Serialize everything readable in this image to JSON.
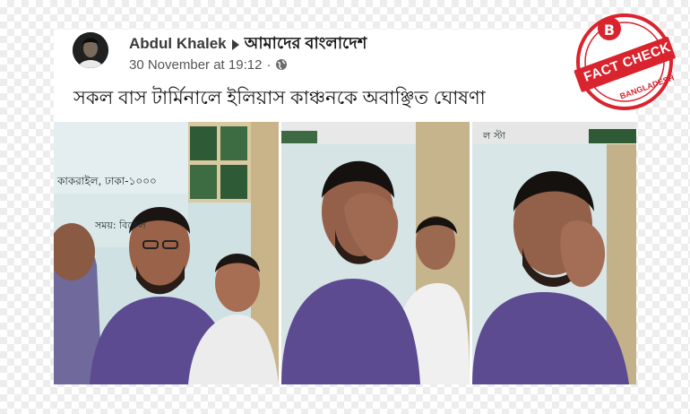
{
  "post": {
    "author": "Abdul Khalek",
    "group": "আমাদের বাংলাদেশ",
    "timestamp": "30 November at 19:12",
    "separator": "·",
    "text": "সকল বাস টার্মিনালে ইলিয়াস কাঞ্চনকে অবাঞ্ছিত ঘোষণা"
  },
  "photos": {
    "banner_text": "কাকরাইল, ঢাকা-১০০০",
    "banner_text_2": "সময়: বিকেল",
    "banner_text_3": "ল স্টা"
  },
  "badge": {
    "letter": "B",
    "top_text": "FACT CHECK",
    "bottom_text": "BANGLADESH",
    "color": "#d9232d"
  },
  "colors": {
    "shirt": "#5a4a8a",
    "background_tile": "#ededed"
  },
  "icons": {
    "arrow": "right-triangle-icon",
    "globe": "globe-icon"
  }
}
